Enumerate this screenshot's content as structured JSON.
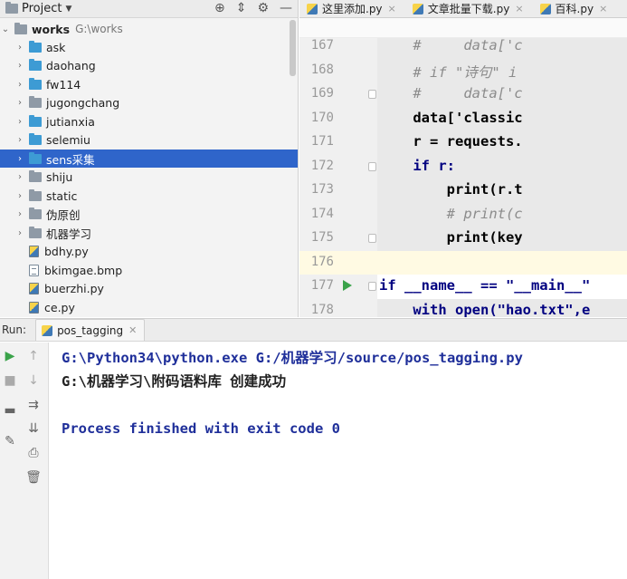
{
  "project_panel": {
    "title": "Project",
    "root": {
      "name": "works",
      "path": "G:\\works"
    },
    "items": [
      {
        "label": "ask",
        "kind": "folder",
        "color": "blue"
      },
      {
        "label": "daohang",
        "kind": "folder",
        "color": "blue"
      },
      {
        "label": "fw114",
        "kind": "folder",
        "color": "blue"
      },
      {
        "label": "jugongchang",
        "kind": "folder",
        "color": "grey"
      },
      {
        "label": "jutianxia",
        "kind": "folder",
        "color": "blue"
      },
      {
        "label": "selemiu",
        "kind": "folder",
        "color": "blue"
      },
      {
        "label": "sens采集",
        "kind": "folder",
        "color": "blue",
        "selected": true
      },
      {
        "label": "shiju",
        "kind": "folder",
        "color": "grey"
      },
      {
        "label": "static",
        "kind": "folder",
        "color": "grey"
      },
      {
        "label": "伪原创",
        "kind": "folder",
        "color": "grey"
      },
      {
        "label": "机器学习",
        "kind": "folder",
        "color": "grey"
      },
      {
        "label": "bdhy.py",
        "kind": "py"
      },
      {
        "label": "bkimgae.bmp",
        "kind": "img"
      },
      {
        "label": "buerzhi.py",
        "kind": "py"
      },
      {
        "label": "ce.py",
        "kind": "py"
      }
    ]
  },
  "editor": {
    "tabs": [
      {
        "label": "这里添加.py"
      },
      {
        "label": "文章批量下载.py"
      },
      {
        "label": "百科.py"
      }
    ],
    "lines": [
      {
        "no": "167",
        "text": "    #     data['c"
      },
      {
        "no": "168",
        "text": "    # if \"诗句\" i"
      },
      {
        "no": "169",
        "text": "    #     data['c"
      },
      {
        "no": "170",
        "text": "    data['classic"
      },
      {
        "no": "171",
        "text": "    r = requests."
      },
      {
        "no": "172",
        "text": "    if r:"
      },
      {
        "no": "173",
        "text": "        print(r.t"
      },
      {
        "no": "174",
        "text": "        # print(c"
      },
      {
        "no": "175",
        "text": "        print(key"
      },
      {
        "no": "176",
        "text": ""
      },
      {
        "no": "177",
        "text": "if __name__ == \"__main__\""
      },
      {
        "no": "178",
        "text": "    with open(\"hao.txt\",e"
      }
    ]
  },
  "run": {
    "label": "Run:",
    "tab": "pos_tagging",
    "console": [
      "G:\\Python34\\python.exe G:/机器学习/source/pos_tagging.py",
      "G:\\机器学习\\附码语料库 创建成功",
      "",
      "Process finished with exit code 0"
    ]
  },
  "colors": {
    "selection": "#2f65ca",
    "keyword": "#000080",
    "string": "#008080",
    "comment": "#8c8c8c",
    "console_cmd": "#1f2f9a"
  }
}
